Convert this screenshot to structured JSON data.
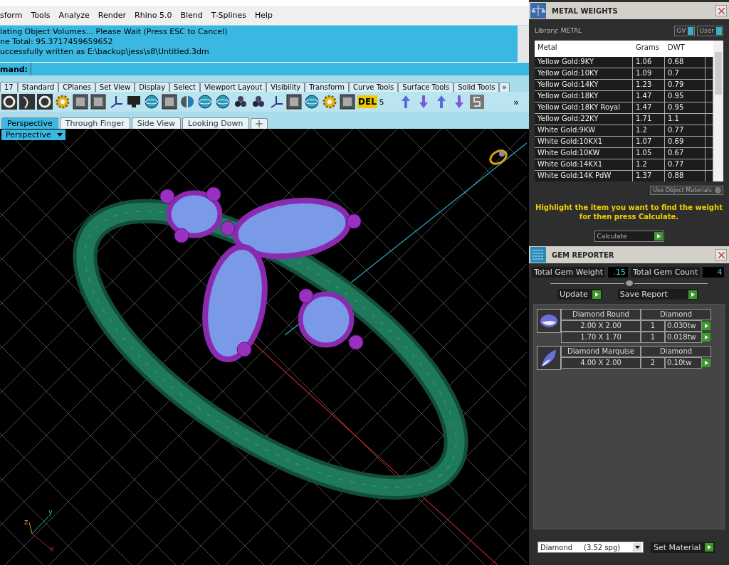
{
  "menu": [
    "sform",
    "Tools",
    "Analyze",
    "Render",
    "Rhino 5.0",
    "Blend",
    "T-Splines",
    "Help"
  ],
  "command_history": [
    "lating Object Volumes... Please Wait (Press ESC to Cancel)",
    "ne Total: 95.3717459659652",
    "uccessfully written as E:\\backup\\jess\\s8\\Untitled.3dm"
  ],
  "command_prompt": "mand:",
  "toolbar_tabs": [
    "17",
    "Standard",
    "CPlanes",
    "Set View",
    "Display",
    "Select",
    "Viewport Layout",
    "Visibility",
    "Transform",
    "Curve Tools",
    "Surface Tools",
    "Solid Tools"
  ],
  "toolbar_overflow": "»",
  "toolbar_texts": {
    "del_icon": "DEL",
    "s_label": "S",
    "more": "»"
  },
  "viewport_tabs": [
    {
      "label": "Perspective",
      "selected": true
    },
    {
      "label": "Through Finger",
      "selected": false
    },
    {
      "label": "Side View",
      "selected": false
    },
    {
      "label": "Looking Down",
      "selected": false
    }
  ],
  "viewport_label": "Perspective",
  "axis_labels": {
    "x": "x",
    "y": "y",
    "z": "z"
  },
  "metal_weights": {
    "title": "METAL WEIGHTS",
    "library": "Library: METAL",
    "toggles": [
      {
        "label": "GV",
        "on": true
      },
      {
        "label": "User",
        "on": true
      }
    ],
    "columns": [
      "Metal",
      "Grams",
      "DWT"
    ],
    "rows": [
      {
        "metal": "Yellow Gold:9KY",
        "grams": "1.06",
        "dwt": "0.68"
      },
      {
        "metal": "Yellow Gold:10KY",
        "grams": "1.09",
        "dwt": "0.7"
      },
      {
        "metal": "Yellow Gold:14KY",
        "grams": "1.23",
        "dwt": "0.79"
      },
      {
        "metal": "Yellow Gold:18KY",
        "grams": "1.47",
        "dwt": "0.95"
      },
      {
        "metal": "Yellow Gold:18KY Royal",
        "grams": "1.47",
        "dwt": "0.95"
      },
      {
        "metal": "Yellow Gold:22KY",
        "grams": "1.71",
        "dwt": "1.1"
      },
      {
        "metal": "White Gold:9KW",
        "grams": "1.2",
        "dwt": "0.77"
      },
      {
        "metal": "White Gold:10KX1",
        "grams": "1.07",
        "dwt": "0.69"
      },
      {
        "metal": "White Gold:10KW",
        "grams": "1.05",
        "dwt": "0.67"
      },
      {
        "metal": "White Gold:14KX1",
        "grams": "1.2",
        "dwt": "0.77"
      },
      {
        "metal": "White Gold:14K PdW",
        "grams": "1.37",
        "dwt": "0.88"
      }
    ],
    "use_object_materials": {
      "label": "Use Object Materials",
      "on": false
    },
    "hint": "Highlight the item you want to find the weight for then press Calculate.",
    "calculate": "Calculate"
  },
  "gem_reporter": {
    "title": "GEM REPORTER",
    "total_weight_label": "Total Gem Weight",
    "total_weight": ".15",
    "total_count_label": "Total Gem Count",
    "total_count": "4",
    "buttons": [
      "Update",
      "Save Report"
    ],
    "groups": [
      {
        "kind": "round",
        "name": "Diamond Round",
        "material": "Diamond",
        "sizes": [
          {
            "size": "2.00 X 2.00",
            "count": "1",
            "weight": "0.030tw"
          },
          {
            "size": "1.70 X 1.70",
            "count": "1",
            "weight": "0.018tw"
          }
        ]
      },
      {
        "kind": "marquise",
        "name": "Diamond Marquise",
        "material": "Diamond",
        "sizes": [
          {
            "size": "4.00 X 2.00",
            "count": "2",
            "weight": "0.10tw"
          }
        ]
      }
    ],
    "material_select": "Diamond     (3.52 spg)",
    "set_material": "Set Material"
  }
}
